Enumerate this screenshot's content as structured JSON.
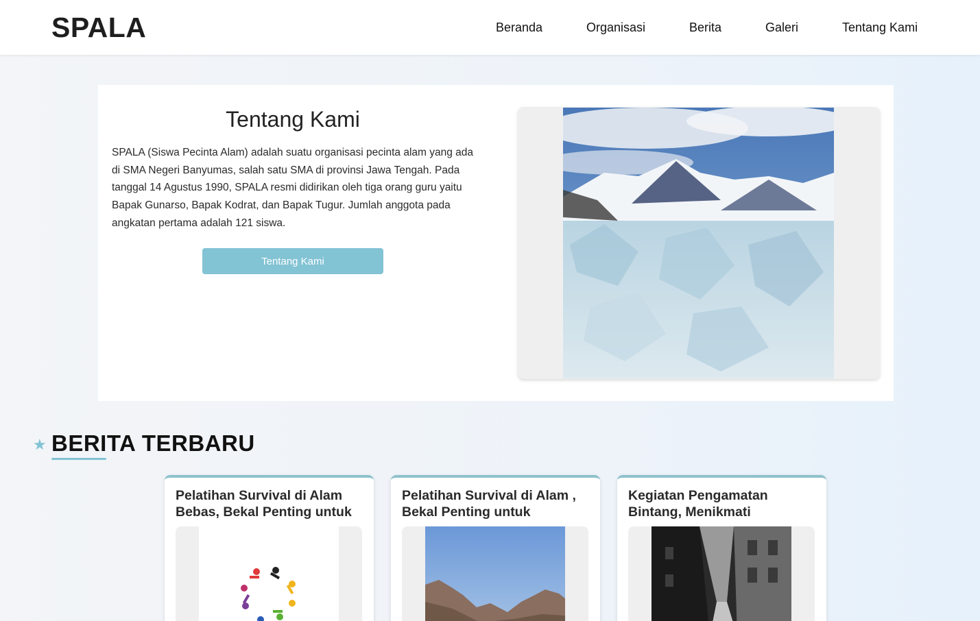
{
  "header": {
    "brand": "SPALA",
    "nav": [
      {
        "label": "Beranda"
      },
      {
        "label": "Organisasi"
      },
      {
        "label": "Berita"
      },
      {
        "label": "Galeri"
      },
      {
        "label": "Tentang Kami"
      }
    ]
  },
  "about": {
    "title": "Tentang Kami",
    "text": "SPALA (Siswa Pecinta Alam) adalah suatu organisasi pecinta alam yang ada di SMA Negeri Banyumas, salah satu SMA di provinsi Jawa Tengah. Pada tanggal 14 Agustus 1990, SPALA resmi didirikan oleh tiga orang guru yaitu Bapak Gunarso, Bapak Kodrat, dan Bapak Tugur. Jumlah anggota pada angkatan pertama adalah 121 siswa.",
    "button_label": "Tentang Kami"
  },
  "news_section": {
    "title": "BERITA TERBARU",
    "items": [
      {
        "title": "Pelatihan Survival di Alam Bebas, Bekal Penting untuk"
      },
      {
        "title": "Pelatihan Survival di Alam , Bekal Penting untuk"
      },
      {
        "title": "Kegiatan Pengamatan Bintang, Menikmati"
      }
    ]
  },
  "colors": {
    "accent": "#82c3d4",
    "card_border": "#8fc1cc"
  }
}
